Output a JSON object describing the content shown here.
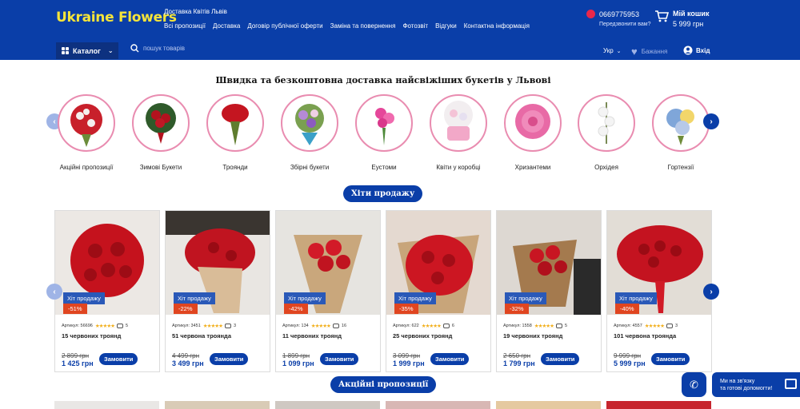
{
  "header": {
    "logo": "Ukraine Flowers",
    "city": "Доставка Квітів Львів",
    "nav": [
      "Всі пропозиції",
      "Доставка",
      "Договір публічної оферти",
      "Заміна та повернення",
      "Фотозвіт",
      "Відгуки",
      "Контактна інформація"
    ],
    "phone": "0669775953",
    "callback": "Передзвонити вам?",
    "cart_title": "Мій кошик",
    "cart_sum": "5 999 грн",
    "catalog_label": "Каталог",
    "search_placeholder": "пошук товарів",
    "lang": "Укр",
    "wishlist": "Бажання",
    "login": "Вхід"
  },
  "headline": "Швидка та безкоштовна доставка найсвіжіших букетів у Львові",
  "categories": [
    {
      "label": "Акційні пропозиції",
      "icon": "red-white-bouquet-photo"
    },
    {
      "label": "Зимові Букети",
      "icon": "red-roses-bouquet-photo"
    },
    {
      "label": "Троянди",
      "icon": "red-roses-photo"
    },
    {
      "label": "Збірні букети",
      "icon": "mixed-bouquet-photo"
    },
    {
      "label": "Еустоми",
      "icon": "pink-eustoma-photo"
    },
    {
      "label": "Квіти у коробці",
      "icon": "flower-box-photo"
    },
    {
      "label": "Хризантеми",
      "icon": "pink-chrysanthemum-photo"
    },
    {
      "label": "Орхідея",
      "icon": "white-orchid-photo"
    },
    {
      "label": "Гортензії",
      "icon": "hydrangea-photo"
    }
  ],
  "sections": {
    "bestsellers": "Хіти продажу",
    "promotions": "Акційні пропозиції"
  },
  "products": [
    {
      "hit": "Хіт продажу",
      "discount": "-51%",
      "article": "Артикул: 56696",
      "reviews": "5",
      "name": "15 червоних троянд",
      "old_price": "2 899 грн",
      "price": "1 425 грн",
      "order": "Замовити"
    },
    {
      "hit": "Хіт продажу",
      "discount": "-22%",
      "article": "Артикул: 3451",
      "reviews": "3",
      "name": "51 червона троянда",
      "old_price": "4 499 грн",
      "price": "3 499 грн",
      "order": "Замовити"
    },
    {
      "hit": "Хіт продажу",
      "discount": "-42%",
      "article": "Артикул: 134",
      "reviews": "16",
      "name": "11 червоних троянд",
      "old_price": "1 899 грн",
      "price": "1 099 грн",
      "order": "Замовити"
    },
    {
      "hit": "Хіт продажу",
      "discount": "-35%",
      "article": "Артикул: 622",
      "reviews": "6",
      "name": "25 червоних троянд",
      "old_price": "3 099 грн",
      "price": "1 999 грн",
      "order": "Замовити"
    },
    {
      "hit": "Хіт продажу",
      "discount": "-32%",
      "article": "Артикул: 1558",
      "reviews": "5",
      "name": "19 червоних троянд",
      "old_price": "2 650 грн",
      "price": "1 799 грн",
      "order": "Замовити"
    },
    {
      "hit": "Хіт продажу",
      "discount": "-40%",
      "article": "Артикул: 4557",
      "reviews": "3",
      "name": "101 червона троянда",
      "old_price": "9 999 грн",
      "price": "5 999 грн",
      "order": "Замовити"
    }
  ],
  "stars": "★★★★★",
  "chat": {
    "line1": "Ми на зв'язку",
    "line2": "та готові допомогти!"
  },
  "colors": {
    "brand": "#0a3ea8",
    "accent_logo": "#f5e43a",
    "discount": "#e04520",
    "stars": "#f2b01e"
  }
}
